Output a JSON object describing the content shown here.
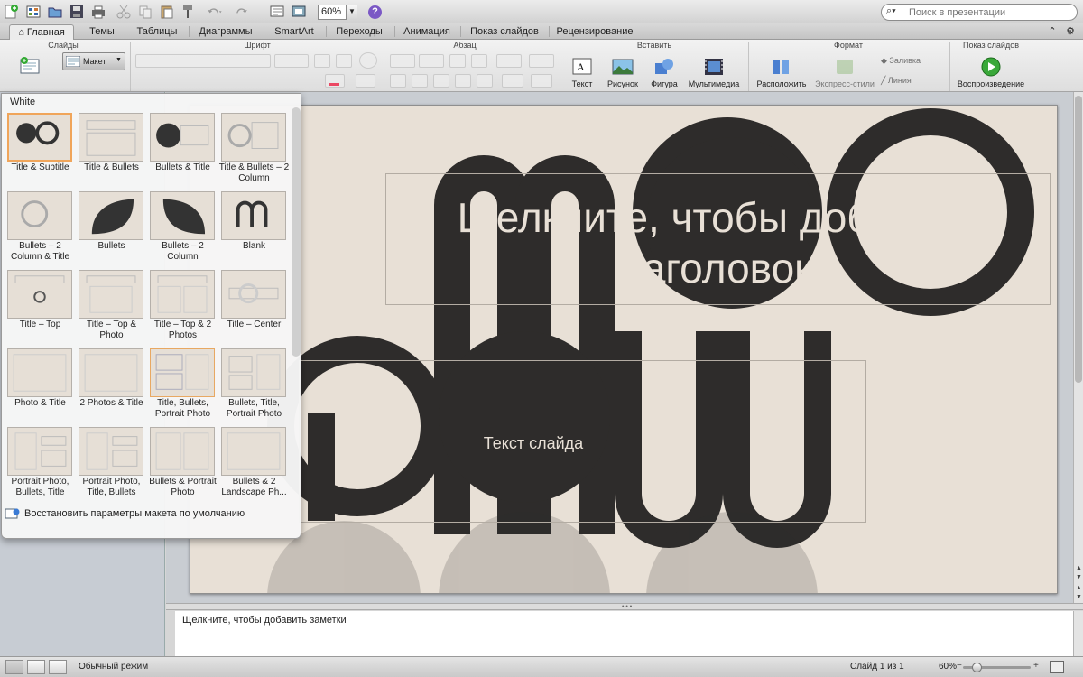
{
  "toolbar": {
    "zoom_value": "60%",
    "help_label": "?",
    "search_placeholder": "Поиск в презентации",
    "icons": [
      "new-icon",
      "gallery-icon",
      "open-icon",
      "save-icon",
      "print-icon",
      "cut-icon",
      "copy-icon",
      "paste-icon",
      "format-painter-icon",
      "undo-icon",
      "redo-icon",
      "slide-show-icon",
      "slide-icon",
      "help-icon"
    ]
  },
  "tabs": [
    {
      "label": "Главная",
      "active": true
    },
    {
      "label": "Темы"
    },
    {
      "label": "Таблицы"
    },
    {
      "label": "Диаграммы"
    },
    {
      "label": "SmartArt"
    },
    {
      "label": "Переходы"
    },
    {
      "label": "Анимация"
    },
    {
      "label": "Показ слайдов"
    },
    {
      "label": "Рецензирование"
    }
  ],
  "ribbon": {
    "groups": {
      "slides": "Слайды",
      "font": "Шрифт",
      "paragraph": "Абзац",
      "insert": "Вставить",
      "format": "Формат",
      "slideshow": "Показ слайдов"
    },
    "layout_button": "Макет",
    "insert_buttons": [
      "Текст",
      "Рисунок",
      "Фигура",
      "Мультимедиа"
    ],
    "format_buttons": {
      "arrange": "Расположить",
      "quick_styles": "Экспресс-стили",
      "fill": "Заливка",
      "line": "Линия"
    },
    "play_button": "Воспроизведение"
  },
  "gallery": {
    "title": "White",
    "layouts": [
      {
        "label": "Title & Subtitle",
        "selected": true
      },
      {
        "label": "Title & Bullets"
      },
      {
        "label": "Bullets & Title"
      },
      {
        "label": "Title & Bullets – 2 Column"
      },
      {
        "label": "Bullets – 2 Column & Title"
      },
      {
        "label": "Bullets"
      },
      {
        "label": "Bullets – 2 Column"
      },
      {
        "label": "Blank"
      },
      {
        "label": "Title – Top"
      },
      {
        "label": "Title – Top & Photo"
      },
      {
        "label": "Title – Top & 2 Photos"
      },
      {
        "label": "Title – Center"
      },
      {
        "label": "Photo & Title"
      },
      {
        "label": "2 Photos & Title"
      },
      {
        "label": "Title, Bullets, Portrait Photo",
        "hovered": true
      },
      {
        "label": "Bullets, Title, Portrait Photo"
      },
      {
        "label": "Portrait Photo, Bullets, Title"
      },
      {
        "label": "Portrait Photo, Title, Bullets"
      },
      {
        "label": "Bullets & Portrait Photo"
      },
      {
        "label": "Bullets & 2 Landscape Ph..."
      }
    ],
    "restore_label": "Восстановить параметры макета по умолчанию"
  },
  "slide": {
    "title_placeholder": "Щелкните, чтобы добавить заголовок",
    "body_placeholder": "Текст слайда",
    "colors": {
      "background": "#e8e0d6",
      "shape": "#2e2c2b"
    }
  },
  "notes": {
    "placeholder": "Щелкните, чтобы добавить заметки"
  },
  "status": {
    "mode": "Обычный режим",
    "slide_counter": "Слайд 1 из 1",
    "zoom": "60%",
    "zoom_fraction": 0.15
  }
}
